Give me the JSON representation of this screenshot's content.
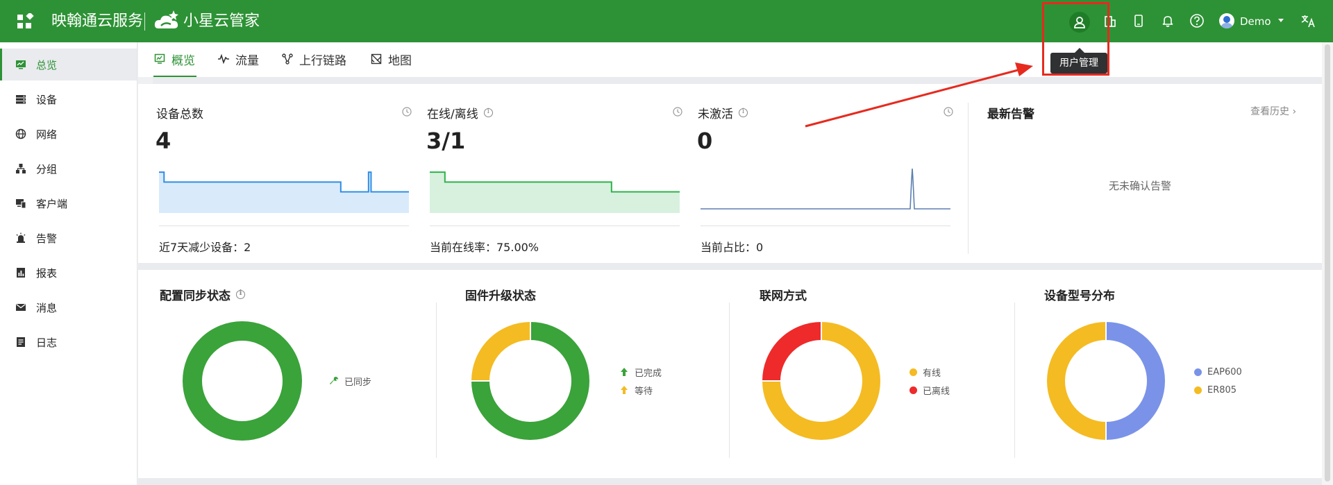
{
  "header": {
    "brand_text": "映翰通云服务",
    "brand2_text": "小星云管家",
    "user_name": "Demo",
    "tooltip": "用户管理",
    "icons": [
      "user-management-icon",
      "building-icon",
      "mobile-icon",
      "bell-icon",
      "help-icon",
      "translate-icon"
    ]
  },
  "sidebar": {
    "items": [
      {
        "label": "总览",
        "icon": "monitor-icon"
      },
      {
        "label": "设备",
        "icon": "device-icon"
      },
      {
        "label": "网络",
        "icon": "globe-icon"
      },
      {
        "label": "分组",
        "icon": "group-icon"
      },
      {
        "label": "客户端",
        "icon": "client-icon"
      },
      {
        "label": "告警",
        "icon": "alarm-icon"
      },
      {
        "label": "报表",
        "icon": "report-icon"
      },
      {
        "label": "消息",
        "icon": "message-icon"
      },
      {
        "label": "日志",
        "icon": "log-icon"
      }
    ]
  },
  "tabs": [
    {
      "label": "概览",
      "icon": "overview-icon"
    },
    {
      "label": "流量",
      "icon": "traffic-icon"
    },
    {
      "label": "上行链路",
      "icon": "uplink-icon"
    },
    {
      "label": "地图",
      "icon": "map-icon"
    }
  ],
  "stats": [
    {
      "title": "设备总数",
      "value": "4",
      "foot": "近7天减少设备：2",
      "color": "#2f8de4",
      "fill": "#d9ebfb",
      "series": [
        4,
        4,
        3,
        3,
        3,
        3,
        3,
        3,
        3,
        3,
        3,
        3,
        3,
        3,
        3,
        3,
        3,
        3,
        3,
        3,
        3,
        3,
        3,
        3,
        3,
        3,
        3,
        3,
        3,
        3,
        3,
        3,
        3,
        3,
        3,
        3,
        3,
        3,
        3,
        3,
        3,
        3,
        3,
        3,
        3,
        3,
        3,
        3,
        3,
        3,
        3,
        3,
        3,
        3,
        3,
        3,
        3,
        3,
        3,
        3,
        3,
        3,
        3,
        3,
        3,
        3,
        3,
        3,
        3,
        3,
        3,
        3,
        2,
        2,
        2,
        2,
        2,
        2,
        2,
        2,
        2,
        2,
        2,
        4,
        2,
        2,
        2,
        2,
        2,
        2,
        2,
        2,
        2,
        2,
        2,
        2,
        2,
        2,
        2,
        2
      ]
    },
    {
      "title": "在线/离线",
      "value": "3/1",
      "foot": "当前在线率：75.00%",
      "color": "#2db24a",
      "fill": "#d8f1df",
      "series": [
        4,
        4,
        4,
        4,
        4,
        4,
        3,
        3,
        3,
        3,
        3,
        3,
        3,
        3,
        3,
        3,
        3,
        3,
        3,
        3,
        3,
        3,
        3,
        3,
        3,
        3,
        3,
        3,
        3,
        3,
        3,
        3,
        3,
        3,
        3,
        3,
        3,
        3,
        3,
        3,
        3,
        3,
        3,
        3,
        3,
        3,
        3,
        3,
        3,
        3,
        3,
        3,
        3,
        3,
        3,
        3,
        3,
        3,
        3,
        3,
        3,
        3,
        3,
        3,
        3,
        3,
        3,
        3,
        3,
        3,
        3,
        3,
        2,
        2,
        2,
        2,
        2,
        2,
        2,
        2,
        2,
        2,
        2,
        2,
        2,
        2,
        2,
        2,
        2,
        2,
        2,
        2,
        2,
        2,
        2,
        2,
        2,
        2,
        2,
        2
      ]
    },
    {
      "title": "未激活",
      "value": "0",
      "foot": "当前占比：0",
      "color": "#5b7fb0",
      "fill": "none"
    }
  ],
  "alarm": {
    "title": "最新告警",
    "history": "查看历史",
    "empty": "无未确认告警"
  },
  "distributions": [
    {
      "title": "配置同步状态",
      "legend": [
        {
          "label": "已同步",
          "icon": "wrench-icon",
          "color": "#3aa33a"
        }
      ]
    },
    {
      "title": "固件升级状态",
      "legend": [
        {
          "label": "已完成",
          "icon": "arrow-up-icon",
          "color": "#3aa33a"
        },
        {
          "label": "等待",
          "icon": "arrow-up-icon",
          "color": "#f4bb22"
        }
      ]
    },
    {
      "title": "联网方式",
      "legend": [
        {
          "label": "有线",
          "color": "#f4bb22"
        },
        {
          "label": "已离线",
          "color": "#ee2a2a"
        }
      ]
    },
    {
      "title": "设备型号分布",
      "legend": [
        {
          "label": "EAP600",
          "color": "#7a93e8"
        },
        {
          "label": "ER805",
          "color": "#f4bb22"
        }
      ]
    }
  ],
  "chart_data": [
    {
      "type": "pie",
      "title": "配置同步状态",
      "categories": [
        "已同步"
      ],
      "values": [
        1
      ],
      "colors": [
        "#3aa33a"
      ]
    },
    {
      "type": "pie",
      "title": "固件升级状态",
      "categories": [
        "已完成",
        "等待"
      ],
      "values": [
        3,
        1
      ],
      "colors": [
        "#3aa33a",
        "#f4bb22"
      ]
    },
    {
      "type": "pie",
      "title": "联网方式",
      "categories": [
        "有线",
        "已离线"
      ],
      "values": [
        3,
        1
      ],
      "colors": [
        "#f4bb22",
        "#ee2a2a"
      ]
    },
    {
      "type": "pie",
      "title": "设备型号分布",
      "categories": [
        "EAP600",
        "ER805"
      ],
      "values": [
        1,
        1
      ],
      "colors": [
        "#7a93e8",
        "#f4bb22"
      ]
    }
  ]
}
